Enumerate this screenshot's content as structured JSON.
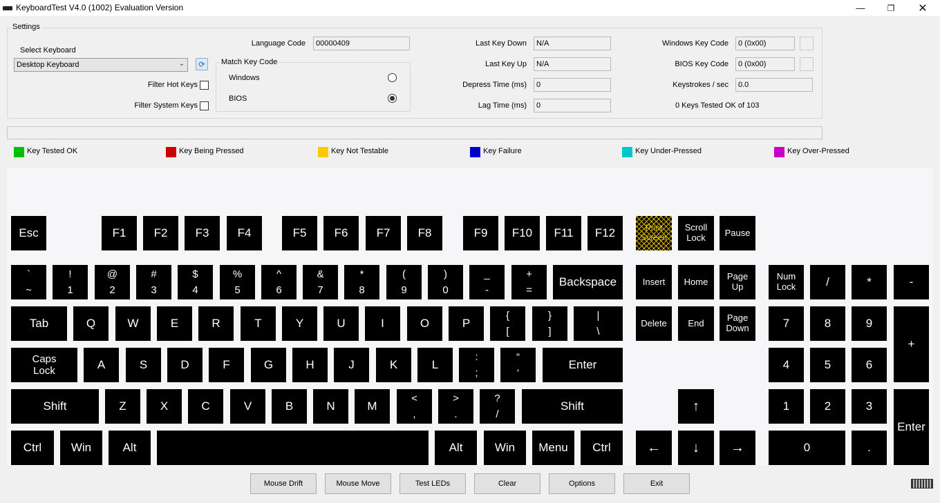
{
  "titlebar": {
    "title": "KeyboardTest V4.0 (1002) Evaluation Version",
    "minimize_icon": "minimize-icon",
    "maximize_icon": "restore-icon",
    "close_icon": "close-icon"
  },
  "settings": {
    "group_label": "Settings",
    "select_keyboard_label": "Select Keyboard",
    "select_keyboard_value": "Desktop Keyboard",
    "filter_hot_keys_label": "Filter Hot Keys",
    "filter_system_keys_label": "Filter System Keys",
    "language_code_label": "Language Code",
    "language_code_value": "00000409",
    "match_key_code_label": "Match Key Code",
    "match_windows_label": "Windows",
    "match_bios_label": "BIOS",
    "last_key_down_label": "Last Key Down",
    "last_key_down_value": "N/A",
    "last_key_up_label": "Last Key Up",
    "last_key_up_value": "N/A",
    "depress_time_label": "Depress Time (ms)",
    "depress_time_value": "0",
    "lag_time_label": "Lag Time (ms)",
    "lag_time_value": "0",
    "windows_key_code_label": "Windows Key Code",
    "windows_key_code_value": "0 (0x00)",
    "bios_key_code_label": "BIOS Key Code",
    "bios_key_code_value": "0 (0x00)",
    "keystrokes_label": "Keystrokes / sec",
    "keystrokes_value": "0.0",
    "keys_tested_text": "0 Keys Tested OK of 103"
  },
  "legend": [
    {
      "label": "Key Tested OK",
      "color": "#00c000"
    },
    {
      "label": "Key Being Pressed",
      "color": "#cc0000"
    },
    {
      "label": "Key Not Testable",
      "color": "#ffc800"
    },
    {
      "label": "Key Failure",
      "color": "#0000cc"
    },
    {
      "label": "Key Under-Pressed",
      "color": "#00c8c8"
    },
    {
      "label": "Key Over-Pressed",
      "color": "#c800c8"
    }
  ],
  "keys": {
    "esc": "Esc",
    "f1": "F1",
    "f2": "F2",
    "f3": "F3",
    "f4": "F4",
    "f5": "F5",
    "f6": "F6",
    "f7": "F7",
    "f8": "F8",
    "f9": "F9",
    "f10": "F10",
    "f11": "F11",
    "f12": "F12",
    "print_screen": "Print\nScreen",
    "scroll_lock": "Scroll\nLock",
    "pause": "Pause",
    "backtick": "`\n~",
    "n1": "!\n1",
    "n2": "@\n2",
    "n3": "#\n3",
    "n4": "$\n4",
    "n5": "%\n5",
    "n6": "^\n6",
    "n7": "&\n7",
    "n8": "*\n8",
    "n9": "(\n9",
    "n0": ")\n0",
    "minus": "_\n-",
    "equals": "+\n=",
    "backspace": "Backspace",
    "insert": "Insert",
    "home": "Home",
    "page_up": "Page\nUp",
    "num_lock": "Num\nLock",
    "num_slash": "/",
    "num_star": "*",
    "num_minus": "-",
    "tab": "Tab",
    "q": "Q",
    "w": "W",
    "e": "E",
    "r": "R",
    "t": "T",
    "y": "Y",
    "u": "U",
    "i": "I",
    "o": "O",
    "p": "P",
    "lbracket": "{\n[",
    "rbracket": "}\n]",
    "backslash": "|\n\\",
    "delete": "Delete",
    "end": "End",
    "page_down": "Page\nDown",
    "num7": "7",
    "num8": "8",
    "num9": "9",
    "num_plus": "+",
    "caps_lock": "Caps\nLock",
    "a": "A",
    "s": "S",
    "d": "D",
    "f": "F",
    "g": "G",
    "h": "H",
    "j": "J",
    "k": "K",
    "l": "L",
    "semicolon": ":\n;",
    "quote": "“\n‘",
    "enter": "Enter",
    "num4": "4",
    "num5": "5",
    "num6": "6",
    "lshift": "Shift",
    "z": "Z",
    "x": "X",
    "c": "C",
    "v": "V",
    "b": "B",
    "n": "N",
    "m": "M",
    "comma": "<\n,",
    "period": ">\n.",
    "slash": "?\n/",
    "rshift": "Shift",
    "up": "↑",
    "num1": "1",
    "num2": "2",
    "num3": "3",
    "num_enter": "Enter",
    "lctrl": "Ctrl",
    "lwin": "Win",
    "lalt": "Alt",
    "space": "",
    "ralt": "Alt",
    "rwin": "Win",
    "menu": "Menu",
    "rctrl": "Ctrl",
    "left": "←",
    "down": "↓",
    "right": "→",
    "num0": "0",
    "num_dot": "."
  },
  "buttons": {
    "mouse_drift": "Mouse Drift",
    "mouse_move": "Mouse Move",
    "test_leds": "Test LEDs",
    "clear": "Clear",
    "options": "Options",
    "exit": "Exit"
  },
  "icons": {
    "app": "keyboard-icon",
    "refresh": "refresh-icon",
    "status": "keyboard-icon"
  }
}
